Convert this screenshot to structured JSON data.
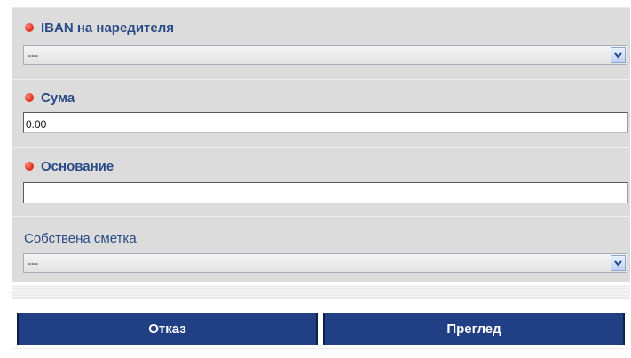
{
  "form": {
    "payer_iban": {
      "label": "IBAN на наредителя",
      "required": true,
      "selected": "---"
    },
    "amount": {
      "label": "Сума",
      "required": true,
      "value": "0.00"
    },
    "reason": {
      "label": "Основание",
      "required": true,
      "value": ""
    },
    "own_account": {
      "label": "Собствена сметка",
      "required": false,
      "selected": "---"
    }
  },
  "buttons": {
    "cancel_label": "Отказ",
    "preview_label": "Преглед"
  },
  "colors": {
    "label_blue": "#2a4a86",
    "button_bg": "#203f84",
    "required_dot": "#e63a2a",
    "panel_bg": "#dcdcdc"
  },
  "icons": {
    "required": "required-dot-icon",
    "dropdown": "chevron-down-icon"
  }
}
